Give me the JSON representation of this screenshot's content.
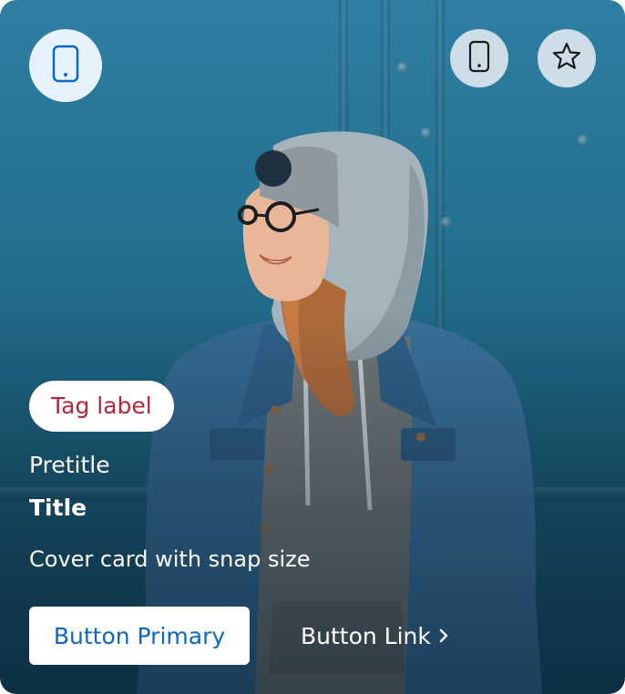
{
  "card": {
    "tag_label": "Tag label",
    "pretitle": "Pretitle",
    "title": "Title",
    "description": "Cover card with snap size",
    "primary_button_label": "Button Primary",
    "link_button_label": "Button Link"
  },
  "icons": {
    "main": "mobile-phone-icon",
    "action_1": "mobile-phone-icon",
    "action_2": "star-icon",
    "link_chevron": "chevron-right-icon"
  },
  "colors": {
    "tag_text": "#b0283a",
    "primary_button_text": "#0b68c0",
    "main_icon_background": "#e6f3fc",
    "main_icon_color": "#0b68c0"
  }
}
